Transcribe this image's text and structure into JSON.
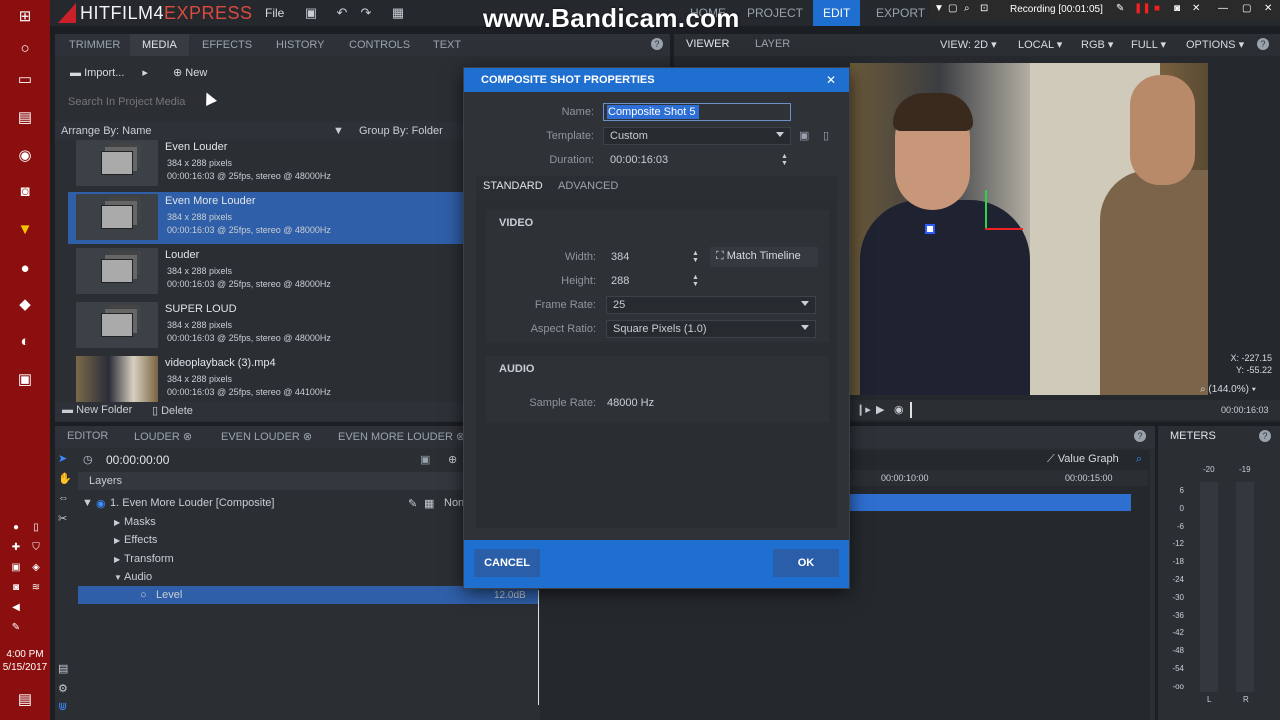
{
  "watermark": "www.Bandicam.com",
  "recorder": {
    "status": "Recording [00:01:05]"
  },
  "app": {
    "title_main": "HITFILM4",
    "title_accent": "EXPRESS",
    "menu_file": "File"
  },
  "nav": {
    "home": "HOME",
    "project": "PROJECT",
    "edit": "EDIT",
    "export": "EXPORT"
  },
  "taskbar": {
    "time": "4:00 PM",
    "date": "5/15/2017"
  },
  "left_panel": {
    "tabs": [
      "TRIMMER",
      "MEDIA",
      "EFFECTS",
      "HISTORY",
      "CONTROLS",
      "TEXT"
    ],
    "import_label": "Import...",
    "new_label": "New",
    "search_placeholder": "Search In Project Media",
    "arrange_by": "Arrange By: Name",
    "group_by": "Group By: Folder",
    "items": [
      {
        "name": "Even Louder",
        "line1": "384 x 288 pixels",
        "line2": "00:00:16:03 @ 25fps, stereo @ 48000Hz"
      },
      {
        "name": "Even More Louder",
        "line1": "384 x 288 pixels",
        "line2": "00:00:16:03 @ 25fps, stereo @ 48000Hz"
      },
      {
        "name": "Louder",
        "line1": "384 x 288 pixels",
        "line2": "00:00:16:03 @ 25fps, stereo @ 48000Hz"
      },
      {
        "name": "SUPER LOUD",
        "line1": "384 x 288 pixels",
        "line2": "00:00:16:03 @ 25fps, stereo @ 48000Hz"
      },
      {
        "name": "videoplayback (3).mp4",
        "line1": "384 x 288 pixels",
        "line2": "00:00:16:03 @ 25fps, stereo @ 44100Hz"
      }
    ],
    "new_folder": "New Folder",
    "delete": "Delete"
  },
  "viewer": {
    "tab_viewer": "VIEWER",
    "tab_layer": "LAYER",
    "view": "VIEW: 2D",
    "space": "LOCAL",
    "channel": "RGB",
    "quality": "FULL",
    "options": "OPTIONS",
    "coord_x": "X: -227.15",
    "coord_y": "Y: -55.22",
    "zoom": "(144.0%)",
    "duration": "00:00:16:03"
  },
  "editor": {
    "tabs": [
      "EDITOR",
      "LOUDER",
      "EVEN LOUDER",
      "EVEN MORE LOUDER"
    ],
    "timecode": "00:00:00:00",
    "layers_label": "Layers",
    "layer_name": "1. Even More Louder [Composite]",
    "blend": "None",
    "rows": [
      "Masks",
      "Effects",
      "Transform",
      "Audio",
      "Level"
    ],
    "level_value": "12.0dB",
    "value_graph": "Value Graph",
    "ticks": [
      "00:00:10:00",
      "00:00:15:00"
    ]
  },
  "meters": {
    "title": "METERS",
    "top_labels": [
      "-20",
      "-19"
    ],
    "scale": [
      "6",
      "0",
      "-6",
      "-12",
      "-18",
      "-24",
      "-30",
      "-36",
      "-42",
      "-48",
      "-54",
      "-oo"
    ],
    "channels": [
      "L",
      "R"
    ]
  },
  "dialog": {
    "title": "COMPOSITE SHOT PROPERTIES",
    "name_label": "Name:",
    "name_value": "Composite Shot 5",
    "template_label": "Template:",
    "template_value": "Custom",
    "duration_label": "Duration:",
    "duration_value": "00:00:16:03",
    "tab_standard": "STANDARD",
    "tab_advanced": "ADVANCED",
    "video_title": "VIDEO",
    "width_label": "Width:",
    "width_value": "384",
    "height_label": "Height:",
    "height_value": "288",
    "match_timeline": "Match Timeline",
    "frame_rate_label": "Frame Rate:",
    "frame_rate_value": "25",
    "aspect_label": "Aspect Ratio:",
    "aspect_value": "Square Pixels (1.0)",
    "audio_title": "AUDIO",
    "sample_rate_label": "Sample Rate:",
    "sample_rate_value": "48000 Hz",
    "cancel": "CANCEL",
    "ok": "OK"
  },
  "colors": {
    "accent": "#1f6fd0",
    "selection": "#2f5fa8",
    "taskbar": "#8c0f0f",
    "brand_red": "#d94a3f"
  }
}
